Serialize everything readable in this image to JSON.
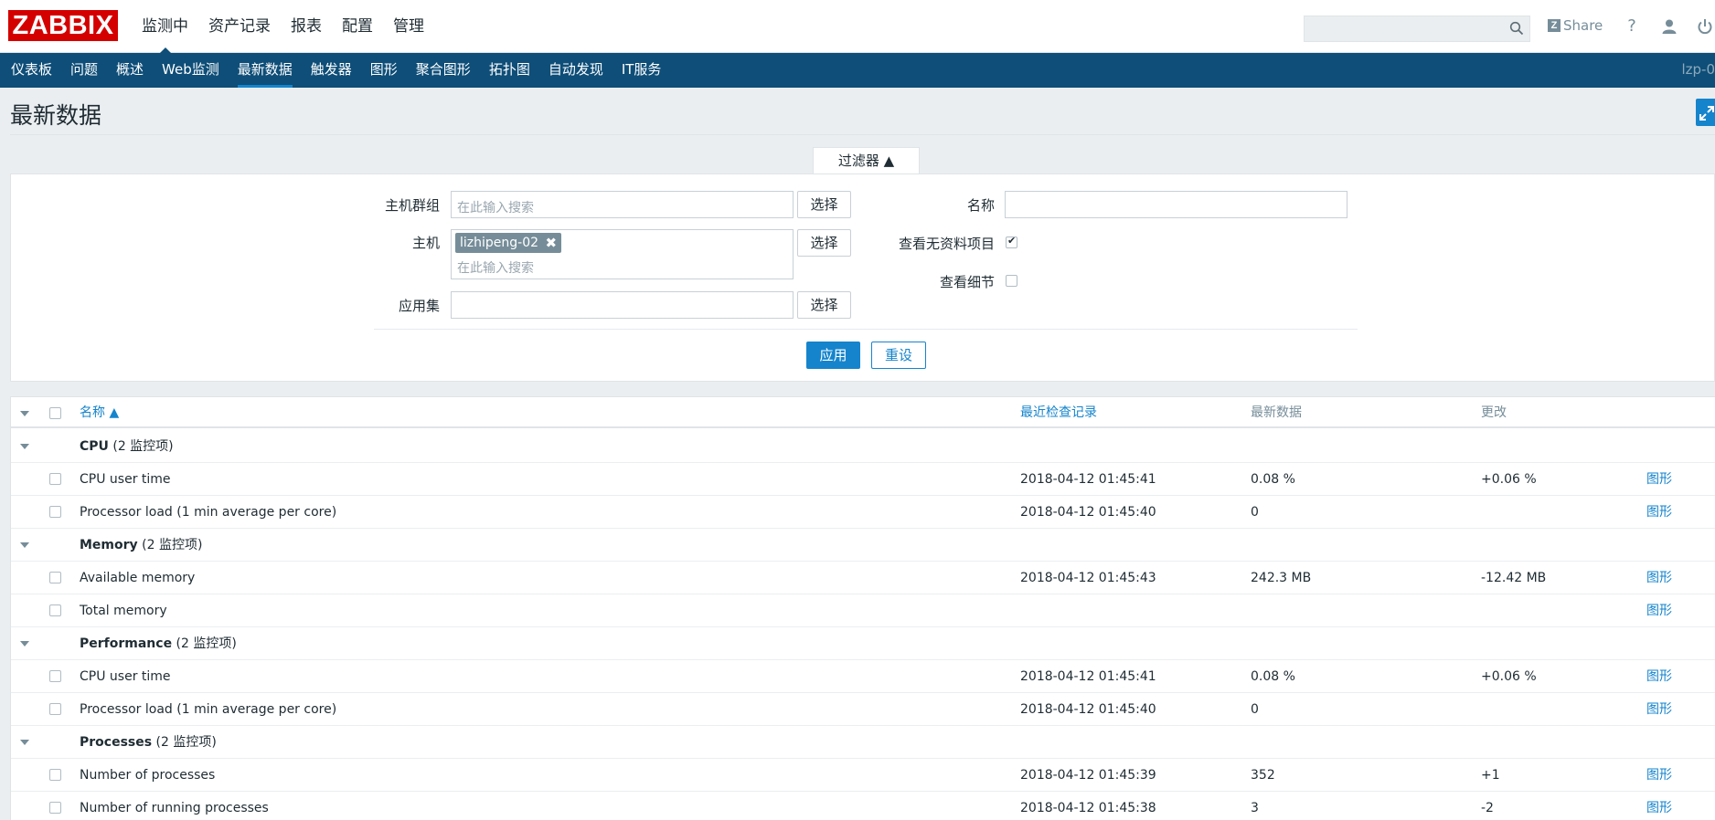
{
  "header": {
    "logo": "ZABBIX",
    "nav": [
      "监测中",
      "资产记录",
      "报表",
      "配置",
      "管理"
    ],
    "active_nav_index": 0,
    "share": "Share",
    "icons": [
      "search-icon",
      "help-icon",
      "user-icon",
      "power-icon"
    ]
  },
  "subnav": {
    "items": [
      "仪表板",
      "问题",
      "概述",
      "Web监测",
      "最新数据",
      "触发器",
      "图形",
      "聚合图形",
      "拓扑图",
      "自动发现",
      "IT服务"
    ],
    "active_index": 4,
    "server": "lzp-0"
  },
  "page": {
    "title": "最新数据"
  },
  "filter": {
    "tab_label": "过滤器 ▲",
    "host_group_label": "主机群组",
    "host_group_placeholder": "在此输入搜索",
    "select_label": "选择",
    "host_label": "主机",
    "host_tag": "lizhipeng-02",
    "host_placeholder": "在此输入搜索",
    "application_label": "应用集",
    "application_value": "",
    "name_label": "名称",
    "name_value": "",
    "show_without_data_label": "查看无资料项目",
    "show_without_data_checked": true,
    "show_details_label": "查看细节",
    "show_details_checked": false,
    "apply_label": "应用",
    "reset_label": "重设"
  },
  "table": {
    "columns": {
      "name": "名称 ▲",
      "last_check": "最近检查记录",
      "last_value": "最新数据",
      "change": "更改"
    },
    "graph_label": "图形",
    "groups": [
      {
        "name": "CPU",
        "count": "(2 监控项)",
        "items": [
          {
            "name": "CPU user time",
            "last_check": "2018-04-12 01:45:41",
            "last_value": "0.08 %",
            "change": "+0.06 %"
          },
          {
            "name": "Processor load (1 min average per core)",
            "last_check": "2018-04-12 01:45:40",
            "last_value": "0",
            "change": ""
          }
        ]
      },
      {
        "name": "Memory",
        "count": "(2 监控项)",
        "items": [
          {
            "name": "Available memory",
            "last_check": "2018-04-12 01:45:43",
            "last_value": "242.3 MB",
            "change": "-12.42 MB"
          },
          {
            "name": "Total memory",
            "last_check": "",
            "last_value": "",
            "change": ""
          }
        ]
      },
      {
        "name": "Performance",
        "count": "(2 监控项)",
        "items": [
          {
            "name": "CPU user time",
            "last_check": "2018-04-12 01:45:41",
            "last_value": "0.08 %",
            "change": "+0.06 %"
          },
          {
            "name": "Processor load (1 min average per core)",
            "last_check": "2018-04-12 01:45:40",
            "last_value": "0",
            "change": ""
          }
        ]
      },
      {
        "name": "Processes",
        "count": "(2 监控项)",
        "items": [
          {
            "name": "Number of processes",
            "last_check": "2018-04-12 01:45:39",
            "last_value": "352",
            "change": "+1"
          },
          {
            "name": "Number of running processes",
            "last_check": "2018-04-12 01:45:38",
            "last_value": "3",
            "change": "-2"
          }
        ]
      }
    ]
  }
}
